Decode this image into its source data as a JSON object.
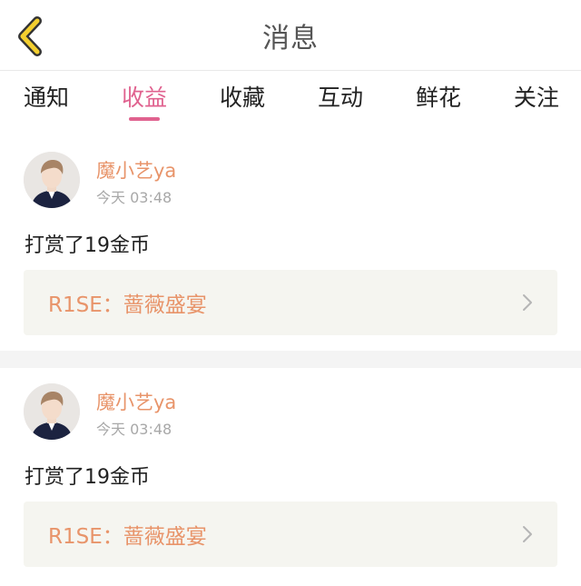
{
  "header": {
    "title": "消息",
    "back_icon": "chevron-left-icon"
  },
  "tabs": [
    {
      "label": "通知",
      "active": false
    },
    {
      "label": "收益",
      "active": true
    },
    {
      "label": "收藏",
      "active": false
    },
    {
      "label": "互动",
      "active": false
    },
    {
      "label": "鲜花",
      "active": false
    },
    {
      "label": "关注",
      "active": false
    }
  ],
  "messages": [
    {
      "username": "魔小艺ya",
      "time": "今天 03:48",
      "text": "打赏了19金币",
      "link_title": "R1SE：蔷薇盛宴"
    },
    {
      "username": "魔小艺ya",
      "time": "今天 03:48",
      "text": "打赏了19金币",
      "link_title": "R1SE：蔷薇盛宴"
    }
  ],
  "colors": {
    "accent": "#e0628f",
    "username": "#e8946a",
    "back_icon": "#f3cf2f"
  }
}
